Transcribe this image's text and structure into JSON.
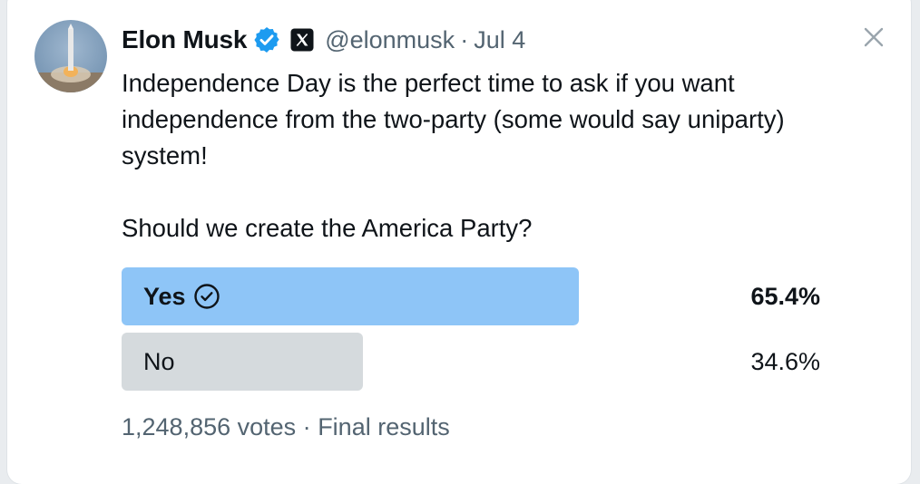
{
  "tweet": {
    "author_name": "Elon Musk",
    "handle": "@elonmusk",
    "separator": "·",
    "date": "Jul 4",
    "text_line1": "Independence Day is the perfect time to ask if you want independence from the two-party (some would say uniparty) system!",
    "question": "Should we create the America Party?",
    "icons": {
      "verified": "verified-badge-icon",
      "affiliation": "x-logo-icon",
      "close": "close-icon",
      "selected": "check-circle-icon"
    },
    "colors": {
      "verified": "#1d9bf0",
      "winning_bar": "#8ec5f7",
      "other_bar": "#d5dadd",
      "secondary_text": "#536471"
    }
  },
  "poll": {
    "options": [
      {
        "label": "Yes",
        "percent_text": "65.4%",
        "fraction": 0.654,
        "selected": true
      },
      {
        "label": "No",
        "percent_text": "34.6%",
        "fraction": 0.346,
        "selected": false
      }
    ],
    "votes": "1,248,856 votes",
    "separator": "·",
    "status": "Final results"
  }
}
